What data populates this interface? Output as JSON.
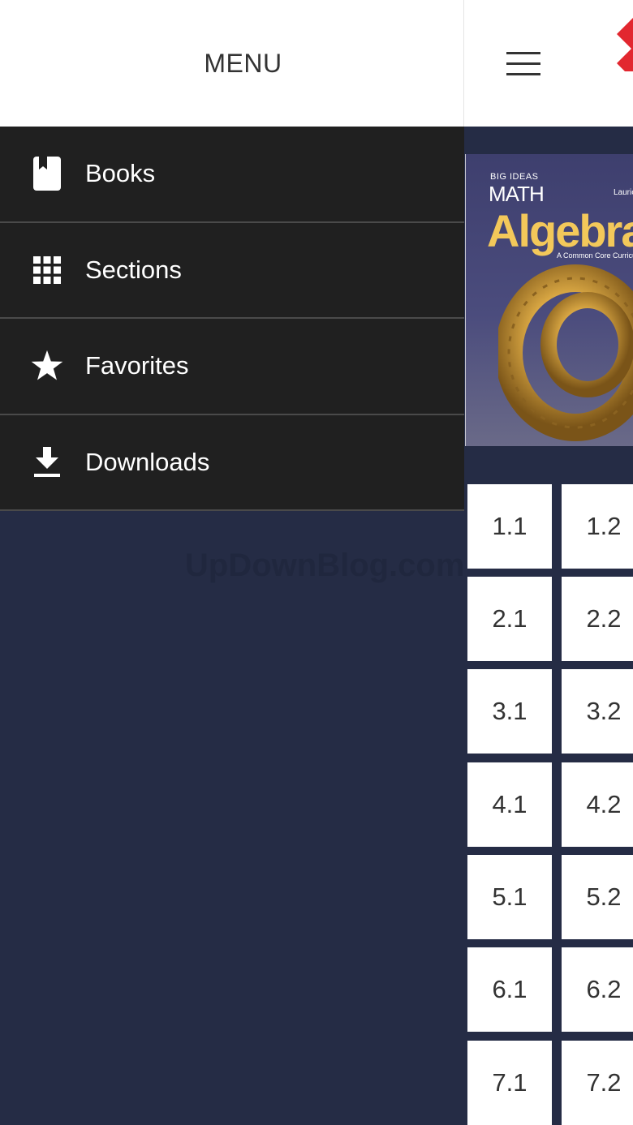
{
  "drawer": {
    "title": "MENU",
    "items": [
      {
        "label": "Books",
        "icon": "book-icon"
      },
      {
        "label": "Sections",
        "icon": "grid-icon"
      },
      {
        "label": "Favorites",
        "icon": "star-icon"
      },
      {
        "label": "Downloads",
        "icon": "download-icon"
      }
    ]
  },
  "book": {
    "publisher": "BIG IDEAS",
    "series": "MATH",
    "title": "Algebra",
    "subtitle": "A Common Core Curriculum",
    "author": "Laurie"
  },
  "sections": [
    [
      "1.1",
      "1.2"
    ],
    [
      "2.1",
      "2.2"
    ],
    [
      "3.1",
      "3.2"
    ],
    [
      "4.1",
      "4.2"
    ],
    [
      "5.1",
      "5.2"
    ],
    [
      "6.1",
      "6.2"
    ],
    [
      "7.1",
      "7.2"
    ]
  ],
  "watermark": "UpDownBlog.com",
  "colors": {
    "background": "#252c45",
    "drawer": "#202020",
    "accent": "#e2272f",
    "cover_title": "#f3c85a"
  }
}
